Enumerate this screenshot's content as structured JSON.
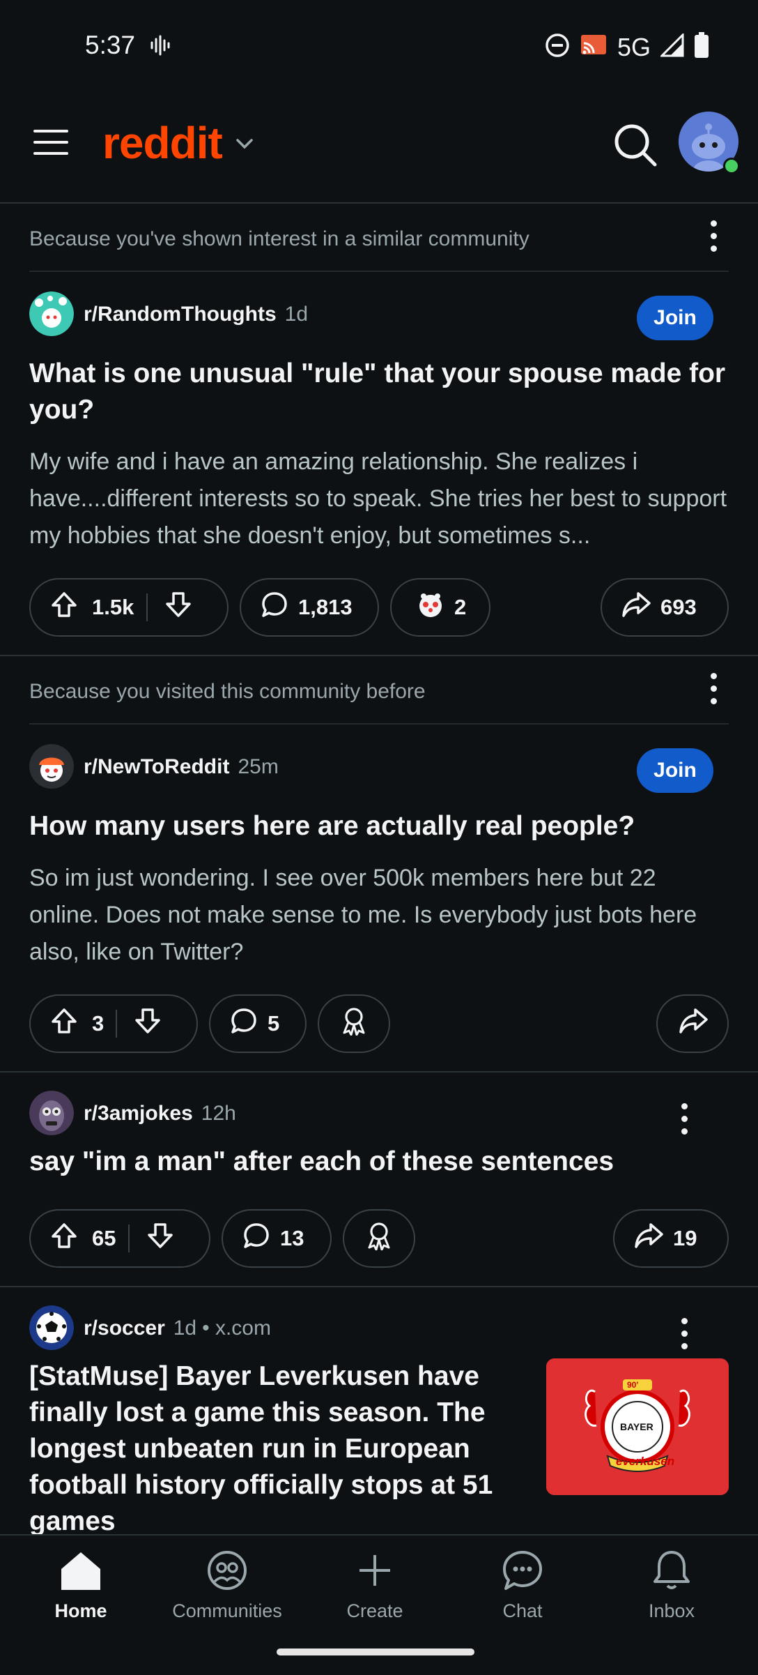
{
  "status_bar": {
    "time": "5:37",
    "network": "5G"
  },
  "app_bar": {
    "logo": "reddit"
  },
  "feed": [
    {
      "reason": "Because you've shown interest in a similar community",
      "subreddit": "r/RandomThoughts",
      "age": "1d",
      "join_label": "Join",
      "title": "What is one unusual \"rule\" that your spouse made for you?",
      "body": "My wife and i have an amazing relationship. She realizes i have....different interests so to speak. She tries her best to support my hobbies that she doesn't enjoy, but sometimes s...",
      "votes": "1.5k",
      "comments": "1,813",
      "awards": "2",
      "shares": "693"
    },
    {
      "reason": "Because you visited this community before",
      "subreddit": "r/NewToReddit",
      "age": "25m",
      "join_label": "Join",
      "title": "How many users here are actually real people?",
      "body": "So im just wondering. I see over 500k members here but 22 online. Does not make sense to me. Is everybody just bots here also, like on Twitter?",
      "votes": "3",
      "comments": "5"
    },
    {
      "subreddit": "r/3amjokes",
      "age": "12h",
      "title": "say \"im a man\" after each of these sentences",
      "votes": "65",
      "comments": "13",
      "shares": "19"
    },
    {
      "subreddit": "r/soccer",
      "age": "1d",
      "domain": "• x.com",
      "title": "[StatMuse] Bayer Leverkusen have finally lost a game this season. The longest unbeaten run in European football history officially stops at 51 games"
    }
  ],
  "bottom_nav": {
    "items": [
      "Home",
      "Communities",
      "Create",
      "Chat",
      "Inbox"
    ]
  },
  "thumbnail_badge": "90'",
  "thumbnail_text": "BAYER",
  "thumbnail_wordmark": "everkusen"
}
